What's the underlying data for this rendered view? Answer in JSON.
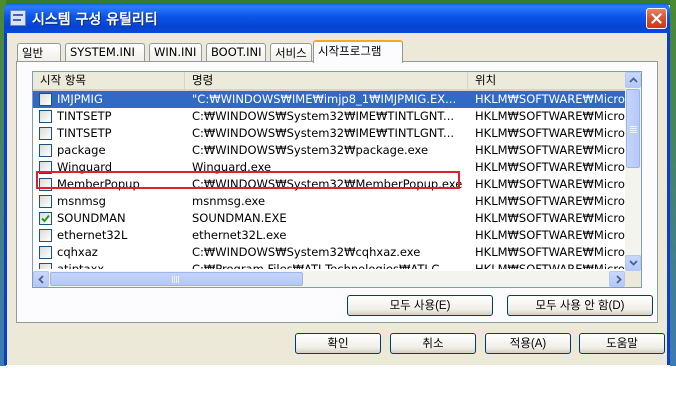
{
  "window": {
    "title": "시스템 구성 유틸리티"
  },
  "tabs": [
    "일반",
    "SYSTEM.INI",
    "WIN.INI",
    "BOOT.INI",
    "서비스",
    "시작프로그램"
  ],
  "active_tab": "시작프로그램",
  "list": {
    "columns": [
      "시작 항목",
      "명령",
      "위치"
    ],
    "rows": [
      {
        "checked": false,
        "name": "IMJPMIG",
        "command": "\"C:₩WINDOWS₩IME₩imjp8_1₩IMJPMIG.EX...",
        "location": "HKLM₩SOFTWARE₩Micros",
        "selected": true
      },
      {
        "checked": false,
        "name": "TINTSETP",
        "command": "C:₩WINDOWS₩System32₩IME₩TINTLGNT...",
        "location": "HKLM₩SOFTWARE₩Micros"
      },
      {
        "checked": false,
        "name": "TINTSETP",
        "command": "C:₩WINDOWS₩System32₩IME₩TINTLGNT...",
        "location": "HKLM₩SOFTWARE₩Micros"
      },
      {
        "checked": false,
        "name": "package",
        "command": "C:₩WINDOWS₩System32₩package.exe",
        "location": "HKLM₩SOFTWARE₩Micros"
      },
      {
        "checked": false,
        "name": "Winguard",
        "command": "Winguard.exe",
        "location": "HKLM₩SOFTWARE₩Micros"
      },
      {
        "checked": false,
        "name": "MemberPopup",
        "command": "C:₩WINDOWS₩System32₩MemberPopup.exe",
        "location": "HKLM₩SOFTWARE₩Micros",
        "highlighted": true
      },
      {
        "checked": false,
        "name": "msnmsg",
        "command": "msnmsg.exe",
        "location": "HKLM₩SOFTWARE₩Micros"
      },
      {
        "checked": true,
        "name": "SOUNDMAN",
        "command": "SOUNDMAN.EXE",
        "location": "HKLM₩SOFTWARE₩Micros"
      },
      {
        "checked": false,
        "name": "ethernet32L",
        "command": "ethernet32L.exe",
        "location": "HKLM₩SOFTWARE₩Micros"
      },
      {
        "checked": false,
        "name": "cqhxaz",
        "command": "C:₩WINDOWS₩System32₩cqhxaz.exe",
        "location": "HKLM₩SOFTWARE₩Micros"
      },
      {
        "checked": false,
        "name": "atiptaxx",
        "command": "C:₩Program Files₩ATI Technologies₩ATI.C...",
        "location": "HKLM₩SOFTWARE₩Micros"
      }
    ]
  },
  "panel_buttons": {
    "enable_all": "모두 사용(E)",
    "disable_all": "모두 사용 안 함(D)"
  },
  "dialog_buttons": {
    "ok": "확인",
    "cancel": "취소",
    "apply": "적용(A)",
    "help": "도움말"
  },
  "colors": {
    "titlebar": "#0a55e8",
    "selection": "#316ac5",
    "highlight_box": "#e0202c",
    "dialog_bg": "#ece9d8"
  }
}
